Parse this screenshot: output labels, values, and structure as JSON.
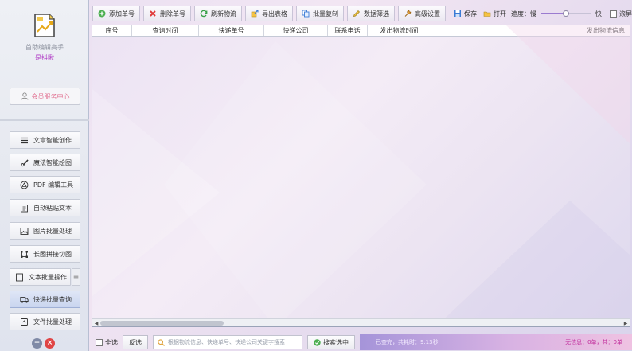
{
  "sidebar": {
    "app_name": "首助编辑高手",
    "app_user": "是抖啾",
    "member_center": "会员服务中心",
    "items": [
      {
        "label": "文章智能创作",
        "icon": "menu-lines-icon"
      },
      {
        "label": "魔法智能绘图",
        "icon": "brush-icon"
      },
      {
        "label": "PDF 编辑工具",
        "icon": "pdf-icon"
      },
      {
        "label": "自动粘贴文本",
        "icon": "paste-icon"
      },
      {
        "label": "图片批量处理",
        "icon": "image-icon"
      },
      {
        "label": "长图拼接切图",
        "icon": "crop-icon"
      },
      {
        "label": "文本批量操作",
        "icon": "text-icon"
      },
      {
        "label": "快递批量查询",
        "icon": "truck-icon"
      },
      {
        "label": "文件批量处理",
        "icon": "file-icon"
      }
    ],
    "toggle_glyph": "≡"
  },
  "toolbar": {
    "add": "添加单号",
    "delete": "删除单号",
    "refresh": "刷新物流",
    "export": "导出表格",
    "batch_copy": "批量复制",
    "filter": "数据筛选",
    "advanced": "高级设置",
    "save": "保存",
    "open": "打开",
    "speed_label": "速度：慢",
    "speed_fast": "快",
    "speed_value": 0.5,
    "scroll_label": "滚屏"
  },
  "table": {
    "columns": [
      "序号",
      "查询时间",
      "快递单号",
      "快递公司",
      "联系电话",
      "发出物流时间",
      "发出物流信息"
    ]
  },
  "bottom": {
    "select_all": "全选",
    "invert": "反选",
    "search_placeholder": "根据物流信息、快递单号、快递公司关键字搜索",
    "search_selected": "搜索选中",
    "status_left": "已查完，共耗时：9.13秒",
    "status_right": "无信息：0单，共：0单"
  },
  "colors": {
    "accent": "#b03cc6",
    "status_text": "#c02a9a"
  }
}
